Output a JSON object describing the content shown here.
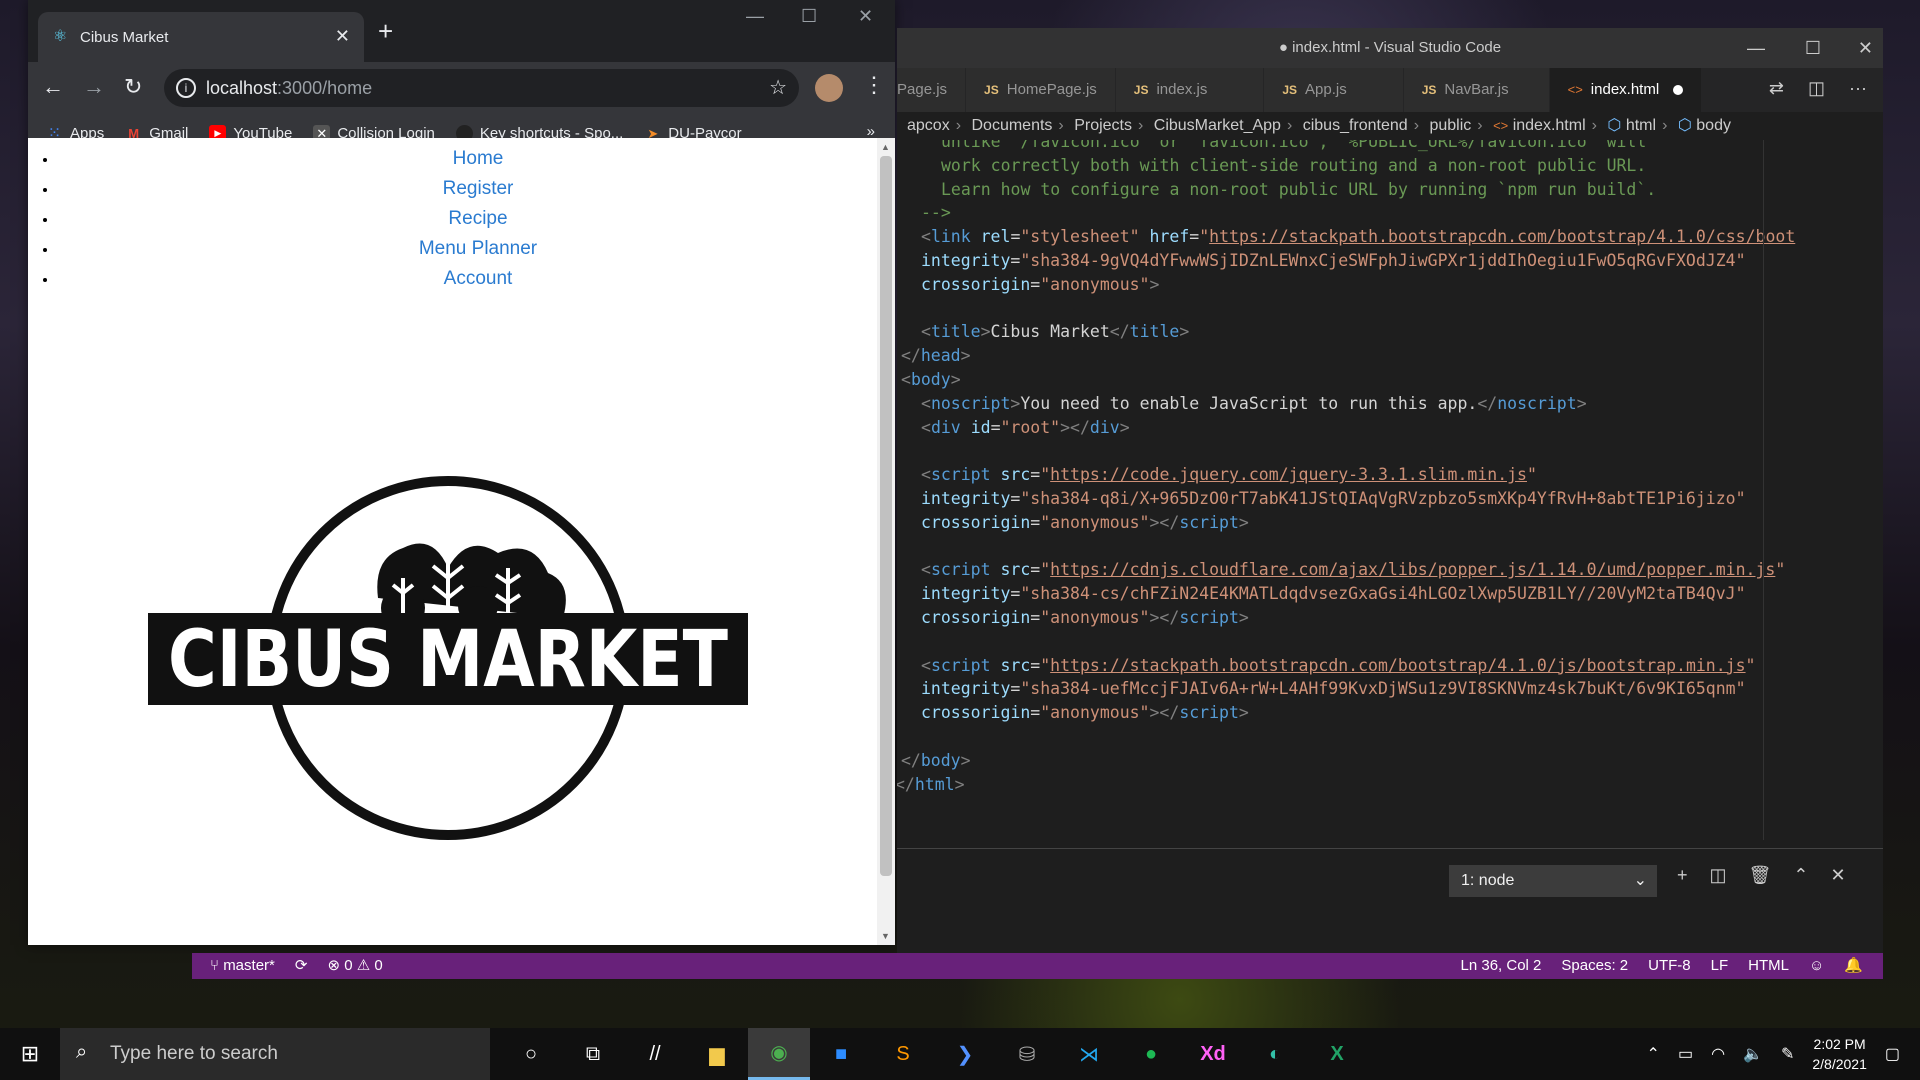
{
  "chrome": {
    "tab_title": "Cibus Market",
    "url_host": "localhost",
    "url_path": ":3000/home",
    "bookmarks": [
      "Apps",
      "Gmail",
      "YouTube",
      "Collision Login",
      "Key shortcuts - Spo...",
      "DU-Paycor"
    ],
    "bookmarks_more": "»"
  },
  "page": {
    "nav": [
      "Home",
      "Register",
      "Recipe",
      "Menu Planner",
      "Account"
    ],
    "logo_text": "CIBUS MARKET"
  },
  "vscode": {
    "title": "● index.html - Visual Studio Code",
    "tabs": [
      "Page.js",
      "HomePage.js",
      "index.js",
      "App.js",
      "NavBar.js",
      "index.html"
    ],
    "breadcrumb": [
      "apcox",
      "Documents",
      "Projects",
      "CibusMarket_App",
      "cibus_frontend",
      "public",
      "index.html",
      "html",
      "body"
    ],
    "terminal_select": "1: node",
    "status": {
      "branch": "master*",
      "errors": "0",
      "warnings": "0",
      "position": "Ln 36, Col 2",
      "spaces": "Spaces: 2",
      "encoding": "UTF-8",
      "eol": "LF",
      "language": "HTML"
    }
  },
  "taskbar": {
    "search_placeholder": "Type here to search",
    "time": "2:02 PM",
    "date": "2/8/2021"
  }
}
